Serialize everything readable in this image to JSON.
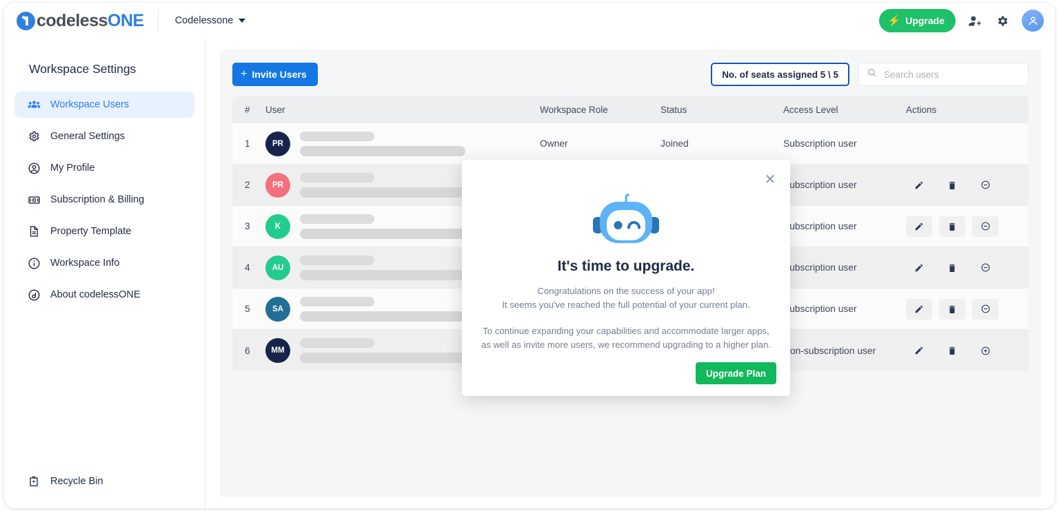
{
  "brand": {
    "text_a": "codeless",
    "text_b": "ONE",
    "mark": "one-logo-icon"
  },
  "topbar": {
    "workspace_name": "Codelessone",
    "upgrade_label": "Upgrade",
    "bolt_glyph": "⚡",
    "icons": {
      "invite": "add-user-icon",
      "settings": "gear-icon",
      "account": "user-avatar-icon"
    }
  },
  "sidebar": {
    "title": "Workspace Settings",
    "items": [
      {
        "label": "Workspace Users",
        "icon": "users-group-icon",
        "active": true
      },
      {
        "label": "General Settings",
        "icon": "gear-icon",
        "active": false
      },
      {
        "label": "My Profile",
        "icon": "user-circle-icon",
        "active": false
      },
      {
        "label": "Subscription & Billing",
        "icon": "banknote-icon",
        "active": false
      },
      {
        "label": "Property Template",
        "icon": "document-icon",
        "active": false
      },
      {
        "label": "Workspace Info",
        "icon": "info-circle-icon",
        "active": false
      },
      {
        "label": "About codelessONE",
        "icon": "about-circle-icon",
        "active": false
      }
    ],
    "recycle_bin": {
      "label": "Recycle Bin",
      "icon": "recycle-bin-icon"
    }
  },
  "toolbar": {
    "invite_label": "Invite Users",
    "plus_glyph": "+",
    "seats_badge": "No. of seats assigned 5 \\ 5",
    "search_placeholder": "Search users",
    "search_value": ""
  },
  "table": {
    "columns": [
      "#",
      "User",
      "Workspace Role",
      "Status",
      "Access Level",
      "Actions"
    ],
    "rows": [
      {
        "num": "1",
        "initials": "PR",
        "color": "#16234a",
        "role": "Owner",
        "status": "Joined",
        "access": "Subscription user",
        "actions": []
      },
      {
        "num": "2",
        "initials": "PR",
        "color": "#f4707f",
        "role": "",
        "status": "",
        "access": "Subscription user",
        "actions": [
          "edit-icon",
          "delete-icon",
          "minus-circle-icon"
        ]
      },
      {
        "num": "3",
        "initials": "K",
        "color": "#23cc8c",
        "role": "",
        "status": "",
        "access": "Subscription user",
        "actions": [
          "edit-icon",
          "delete-icon",
          "minus-circle-icon"
        ]
      },
      {
        "num": "4",
        "initials": "AU",
        "color": "#23cc8c",
        "role": "",
        "status": "",
        "access": "Subscription user",
        "actions": [
          "edit-icon",
          "delete-icon",
          "minus-circle-icon"
        ]
      },
      {
        "num": "5",
        "initials": "SA",
        "color": "#216e96",
        "role": "",
        "status": "",
        "access": "Subscription user",
        "actions": [
          "edit-icon",
          "delete-icon",
          "minus-circle-icon"
        ]
      },
      {
        "num": "6",
        "initials": "MM",
        "color": "#16234a",
        "role": "",
        "status": "",
        "access": "Non-subscription user",
        "actions": [
          "edit-icon",
          "delete-icon",
          "plus-circle-icon"
        ]
      }
    ]
  },
  "modal": {
    "close_glyph": "✕",
    "illustration": "robot-winking-icon",
    "heading": "It's time to upgrade.",
    "para1_line1": "Congratulations on the success of your app!",
    "para1_line2": "It seems you've reached the full potential of your current plan.",
    "para2_line1": "To continue expanding your capabilities and accommodate larger apps,",
    "para2_line2": "as well as invite more users, we recommend upgrading to a higher plan.",
    "cta_label": "Upgrade Plan"
  },
  "colors": {
    "accent_blue": "#1477e3",
    "accent_green": "#1ec06a",
    "cta_green": "#12b85c",
    "active_nav_bg": "#e8f1fe",
    "robot_light": "#5cb3f5",
    "robot_dark": "#2a75b8"
  }
}
